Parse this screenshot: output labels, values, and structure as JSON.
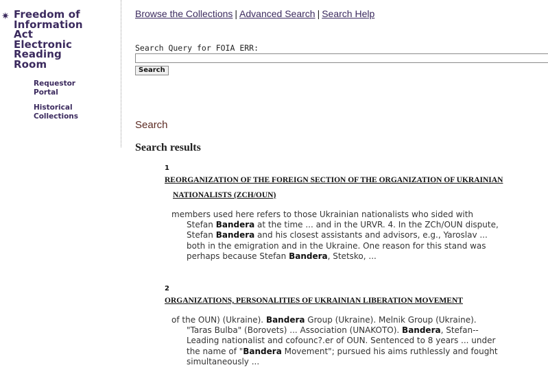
{
  "sidebar": {
    "title_lines": [
      "Freedom of",
      "Information",
      "Act",
      "Electronic",
      "Reading",
      "Room"
    ],
    "links": [
      {
        "line1": "Requestor",
        "line2": "Portal"
      },
      {
        "line1": "Historical",
        "line2": "Collections"
      }
    ]
  },
  "topnav": {
    "browse": "Browse the Collections",
    "advanced": "Advanced Search",
    "help": "Search Help",
    "separator": "|"
  },
  "search": {
    "label": "Search Query for FOIA ERR:",
    "value": "",
    "button": "Search"
  },
  "section_heading": "Search",
  "results_heading": "Search results",
  "results": [
    {
      "number": "1",
      "title_line1": "REORGANIZATION OF THE FOREIGN SECTION OF THE ORGANIZATION OF UKRAINIAN",
      "title_line2": "NATIONALISTS (ZCH/OUN)",
      "snippet_lines": [
        [
          {
            "t": "members used here refers to those Ukrainian nationalists who sided with"
          }
        ],
        [
          {
            "t": "Stefan "
          },
          {
            "b": "Bandera"
          },
          {
            "t": " at the time ... and in the URVR. 4. In the ZCh/OUN dispute,"
          }
        ],
        [
          {
            "t": "Stefan "
          },
          {
            "b": "Bandera"
          },
          {
            "t": " and his closest assistants and advisors, e.g., Yaroslav ..."
          }
        ],
        [
          {
            "t": "both in the emigration and in the Ukraine. One reason for this stand was"
          }
        ],
        [
          {
            "t": "perhaps because Stefan "
          },
          {
            "b": "Bandera"
          },
          {
            "t": ", Stetsko, ..."
          }
        ]
      ]
    },
    {
      "number": "2",
      "title_line1": "ORGANIZATIONS, PERSONALITIES OF UKRAINIAN LIBERATION MOVEMENT",
      "title_line2": "",
      "snippet_lines": [
        [
          {
            "t": "of the OUN) (Ukraine). "
          },
          {
            "b": "Bandera"
          },
          {
            "t": " Group (Ukraine). Melnik Group (Ukraine)."
          }
        ],
        [
          {
            "t": "\"Taras Bulba\" (Borovets) ... Association (UNAKOTO). "
          },
          {
            "b": "Bandera"
          },
          {
            "t": ", Stefan--"
          }
        ],
        [
          {
            "t": "Leading nationalist and cofounc?.er of OUN. Sentenced to 8 years ... under"
          }
        ],
        [
          {
            "t": "the name of \""
          },
          {
            "b": "Bandera"
          },
          {
            "t": " Movement\"; pursued his aims ruthlessly and fought"
          }
        ],
        [
          {
            "t": "simultaneously ..."
          }
        ]
      ]
    }
  ],
  "colors": {
    "brand": "#3b2a5e",
    "section_heading": "#5b2a22"
  },
  "icons": {
    "title_icon": "star-icon"
  }
}
